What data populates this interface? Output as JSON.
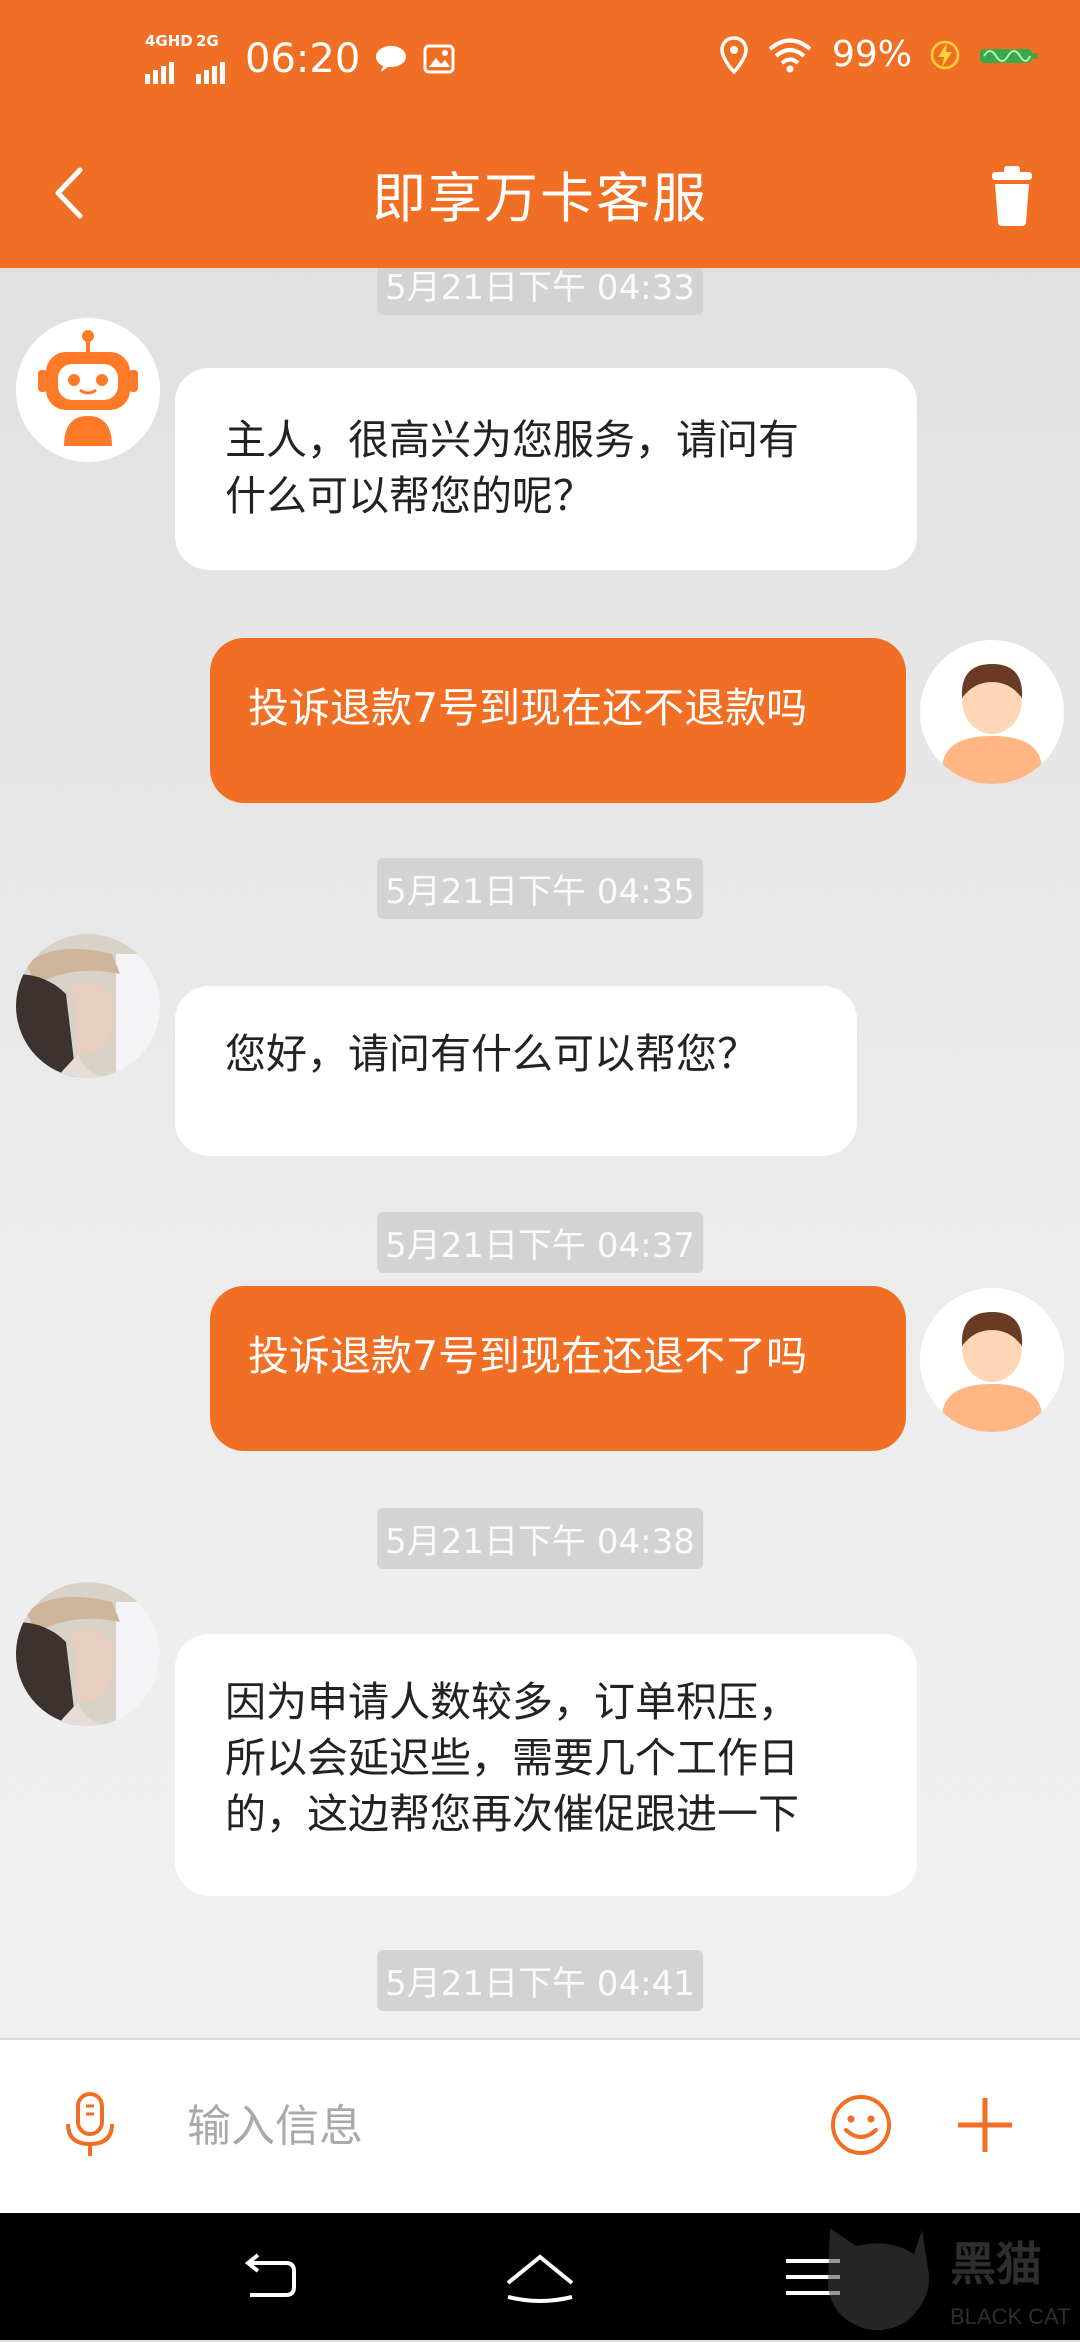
{
  "status_bar": {
    "network_1": "4GHD",
    "network_2": "2G",
    "time": "06:20",
    "battery": "99%"
  },
  "header": {
    "title": "即享万卡客服"
  },
  "colors": {
    "accent": "#f16f24",
    "bubble_in": "#ffffff",
    "timestamp_bg": "#d3d3d3"
  },
  "messages": [
    {
      "type": "timestamp",
      "text": "5月21日下午 04:33"
    },
    {
      "type": "incoming",
      "sender": "robot",
      "lines": [
        "主人，很高兴为您服务，请问有",
        "什么可以帮您的呢？"
      ]
    },
    {
      "type": "outgoing",
      "lines": [
        "投诉退款7号到现在还不退款吗"
      ]
    },
    {
      "type": "timestamp",
      "text": "5月21日下午 04:35"
    },
    {
      "type": "incoming",
      "sender": "agent",
      "lines": [
        "您好，请问有什么可以帮您？"
      ]
    },
    {
      "type": "timestamp",
      "text": "5月21日下午 04:37"
    },
    {
      "type": "outgoing",
      "lines": [
        "投诉退款7号到现在还退不了吗"
      ]
    },
    {
      "type": "timestamp",
      "text": "5月21日下午 04:38"
    },
    {
      "type": "incoming",
      "sender": "agent",
      "lines": [
        "因为申请人数较多，订单积压，",
        "所以会延迟些，需要几个工作日",
        "的，这边帮您再次催促跟进一下"
      ]
    },
    {
      "type": "timestamp",
      "text": "5月21日下午 04:41"
    }
  ],
  "input_bar": {
    "placeholder": "输入信息",
    "mic_icon": "microphone-icon",
    "emoji_icon": "smiley-icon",
    "plus_icon": "plus-icon"
  },
  "nav_bar": {
    "back_icon": "nav-back-icon",
    "home_icon": "nav-home-icon",
    "menu_icon": "nav-menu-icon"
  },
  "watermark": {
    "text_cn": "黑猫",
    "text_en": "BLACK CAT"
  }
}
